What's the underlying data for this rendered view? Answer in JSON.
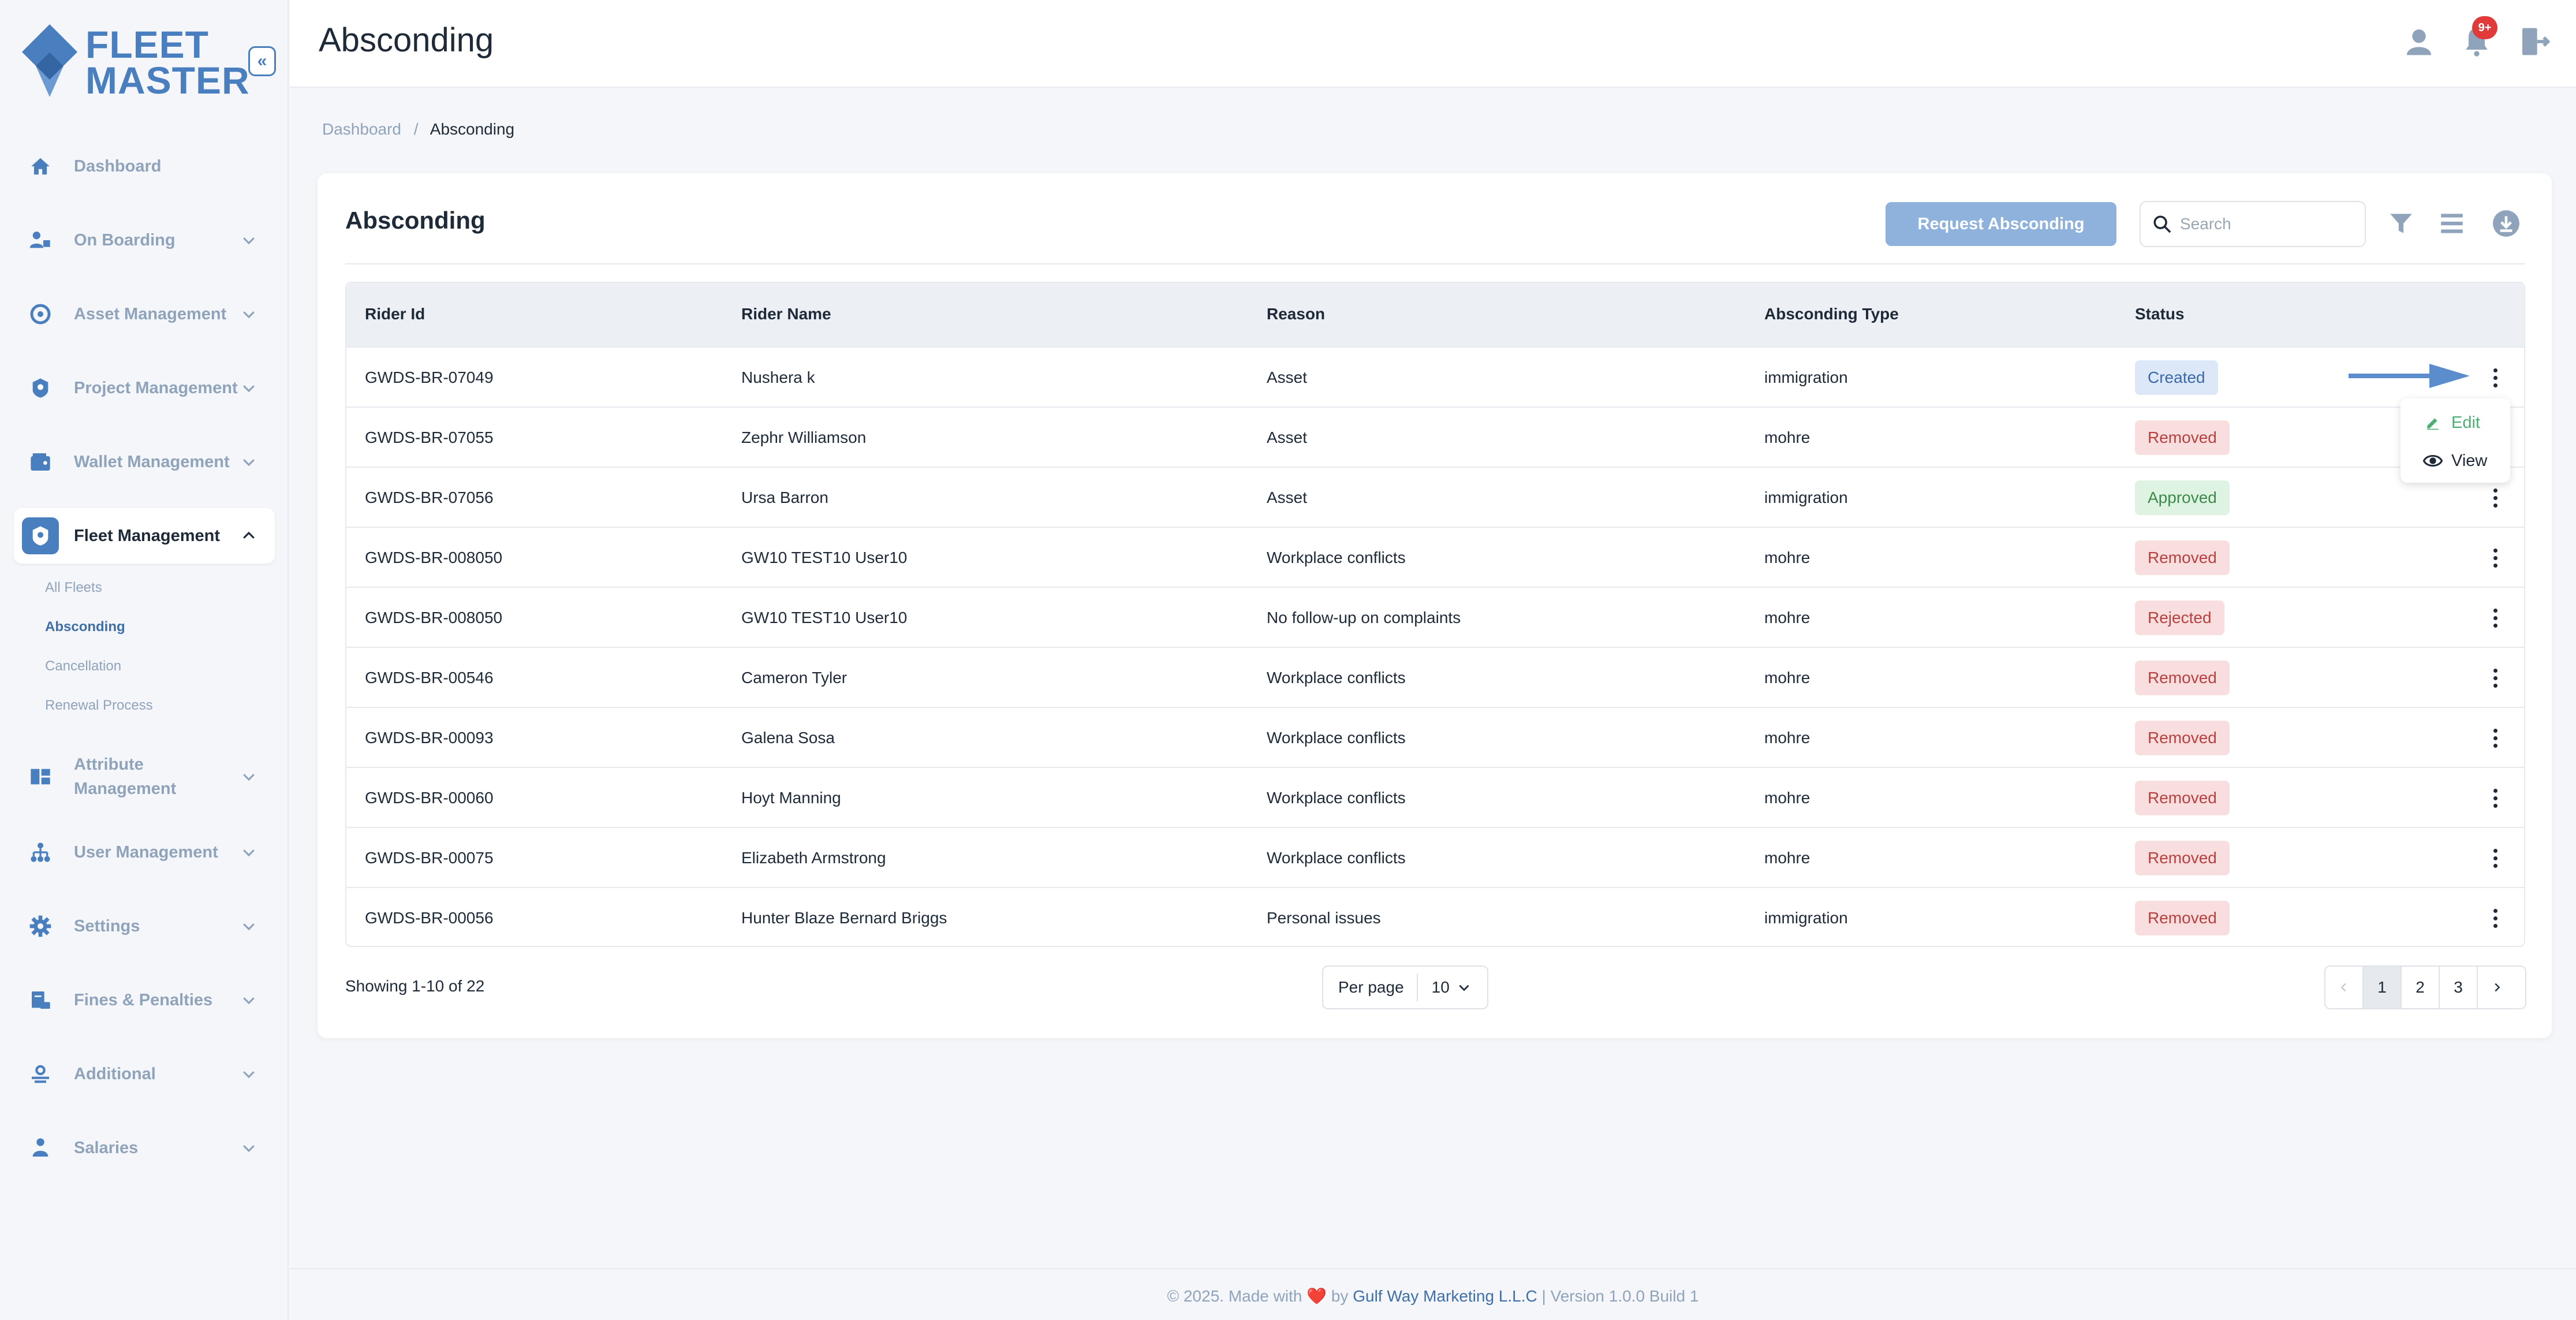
{
  "brand": {
    "line1": "FLEET",
    "line2": "MASTER",
    "accent": "#4a7fbf"
  },
  "sidebar": {
    "collapse_icon": "double-chevron-left-icon",
    "items": [
      {
        "label": "Dashboard",
        "icon": "home-icon",
        "has_children": false
      },
      {
        "label": "On Boarding",
        "icon": "onboarding-icon",
        "has_children": true
      },
      {
        "label": "Asset Management",
        "icon": "asset-icon",
        "has_children": true
      },
      {
        "label": "Project Management",
        "icon": "project-icon",
        "has_children": true
      },
      {
        "label": "Wallet Management",
        "icon": "wallet-icon",
        "has_children": true
      },
      {
        "label": "Fleet Management",
        "icon": "fleet-icon",
        "has_children": true,
        "active": true,
        "children": [
          "All Fleets",
          "Absconding",
          "Cancellation",
          "Renewal Process"
        ],
        "current_child": "Absconding"
      },
      {
        "label_line1": "Attribute",
        "label_line2": "Management",
        "icon": "attribute-icon",
        "has_children": true
      },
      {
        "label": "User Management",
        "icon": "user-management-icon",
        "has_children": true
      },
      {
        "label": "Settings",
        "icon": "gear-icon",
        "has_children": true
      },
      {
        "label": "Fines & Penalties",
        "icon": "fines-icon",
        "has_children": true
      },
      {
        "label": "Additional",
        "icon": "additional-icon",
        "has_children": true
      },
      {
        "label": "Salaries",
        "icon": "salaries-icon",
        "has_children": true
      }
    ]
  },
  "header": {
    "title": "Absconding",
    "notification_badge": "9+"
  },
  "breadcrumb": {
    "root": "Dashboard",
    "sep": "/",
    "current": "Absconding"
  },
  "card": {
    "title": "Absconding",
    "request_button": "Request Absconding",
    "search_placeholder": "Search"
  },
  "table": {
    "columns": [
      "Rider Id",
      "Rider Name",
      "Reason",
      "Absconding Type",
      "Status"
    ],
    "rows": [
      {
        "id": "GWDS-BR-07049",
        "name": "Nushera k",
        "reason": "Asset",
        "type": "immigration",
        "status": "Created"
      },
      {
        "id": "GWDS-BR-07055",
        "name": "Zephr Williamson",
        "reason": "Asset",
        "type": "mohre",
        "status": "Removed"
      },
      {
        "id": "GWDS-BR-07056",
        "name": "Ursa Barron",
        "reason": "Asset",
        "type": "immigration",
        "status": "Approved"
      },
      {
        "id": "GWDS-BR-008050",
        "name": "GW10 TEST10 User10",
        "reason": "Workplace conflicts",
        "type": "mohre",
        "status": "Removed"
      },
      {
        "id": "GWDS-BR-008050",
        "name": "GW10 TEST10 User10",
        "reason": "No follow-up on complaints",
        "type": "mohre",
        "status": "Rejected"
      },
      {
        "id": "GWDS-BR-00546",
        "name": "Cameron Tyler",
        "reason": "Workplace conflicts",
        "type": "mohre",
        "status": "Removed"
      },
      {
        "id": "GWDS-BR-00093",
        "name": "Galena Sosa",
        "reason": "Workplace conflicts",
        "type": "mohre",
        "status": "Removed"
      },
      {
        "id": "GWDS-BR-00060",
        "name": "Hoyt Manning",
        "reason": "Workplace conflicts",
        "type": "mohre",
        "status": "Removed"
      },
      {
        "id": "GWDS-BR-00075",
        "name": "Elizabeth Armstrong",
        "reason": "Workplace conflicts",
        "type": "mohre",
        "status": "Removed"
      },
      {
        "id": "GWDS-BR-00056",
        "name": "Hunter Blaze Bernard Briggs",
        "reason": "Personal issues",
        "type": "immigration",
        "status": "Removed"
      }
    ],
    "row_menu": {
      "edit": "Edit",
      "view": "View"
    }
  },
  "pagination": {
    "showing": "Showing 1-10 of 22",
    "per_page_label": "Per page",
    "per_page_value": "10",
    "pages": [
      "1",
      "2",
      "3"
    ],
    "current_page": "1"
  },
  "footer": {
    "prefix": "© 2025. Made with",
    "heart": "❤️",
    "by": "by",
    "company": "Gulf Way Marketing L.L.C",
    "version": "| Version 1.0.0 Build 1"
  }
}
